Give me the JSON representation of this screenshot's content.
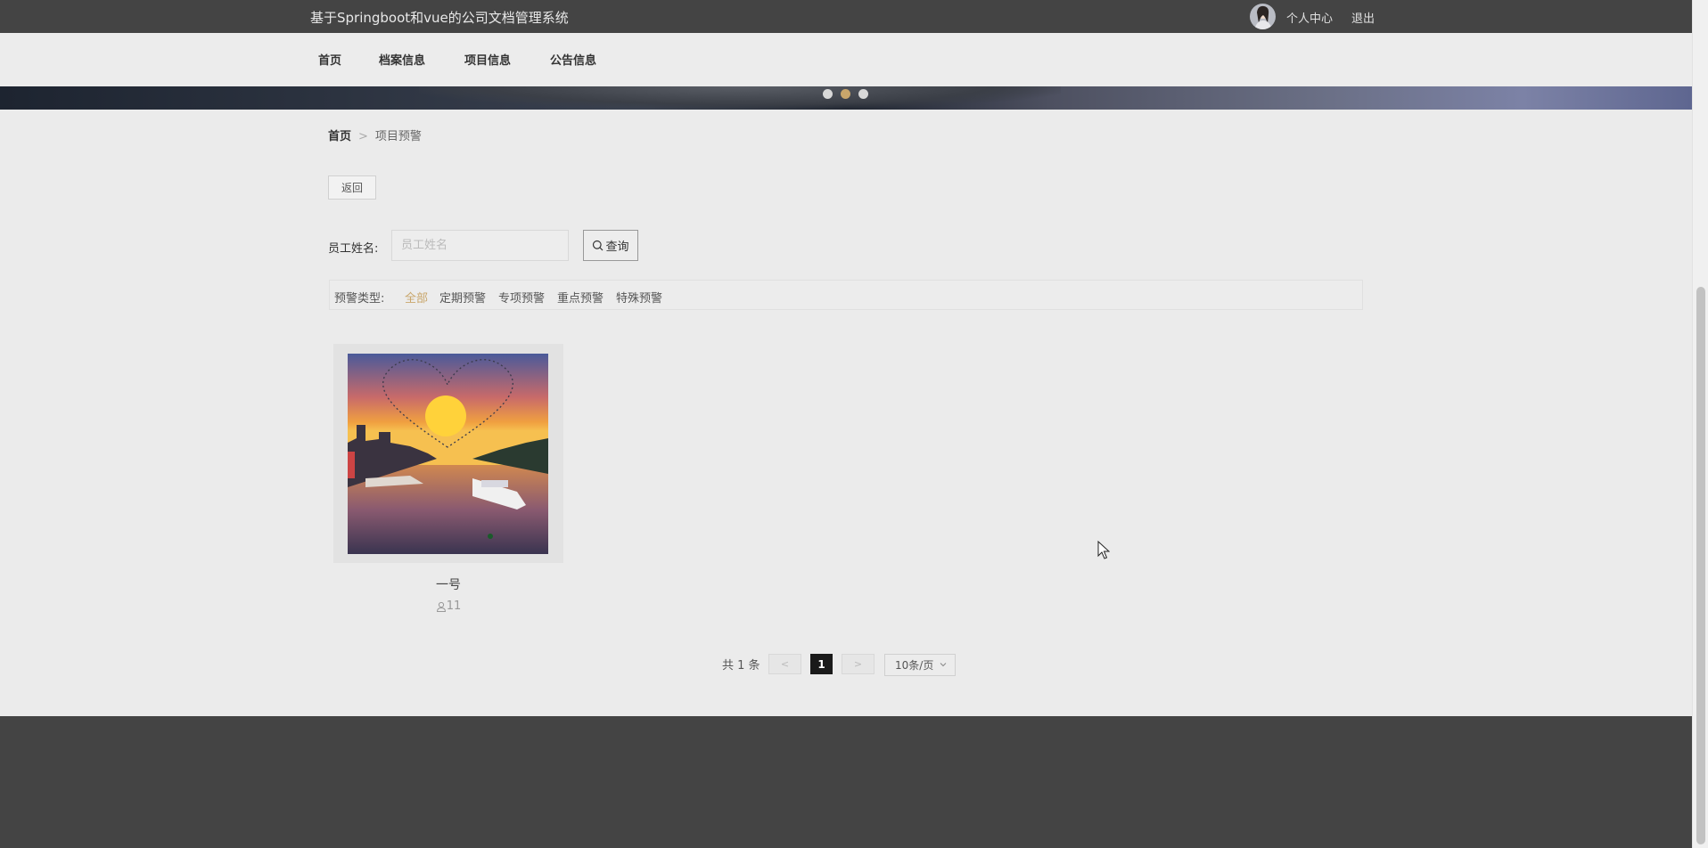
{
  "header": {
    "site_title": "基于Springboot和vue的公司文档管理系统",
    "user_center": "个人中心",
    "logout": "退出"
  },
  "nav": {
    "items": [
      {
        "label": "首页"
      },
      {
        "label": "档案信息"
      },
      {
        "label": "项目信息"
      },
      {
        "label": "公告信息"
      }
    ]
  },
  "carousel": {
    "active_index": 1,
    "count": 3
  },
  "breadcrumb": {
    "home": "首页",
    "separator": ">",
    "current": "项目预警"
  },
  "back_button": "返回",
  "search": {
    "label": "员工姓名:",
    "placeholder": "员工姓名",
    "value": "",
    "button": "查询"
  },
  "filter": {
    "label": "预警类型:",
    "options": [
      {
        "label": "全部",
        "active": true
      },
      {
        "label": "定期预警",
        "active": false
      },
      {
        "label": "专项预警",
        "active": false
      },
      {
        "label": "重点预警",
        "active": false
      },
      {
        "label": "特殊预警",
        "active": false
      }
    ]
  },
  "cards": [
    {
      "name": "一号",
      "count": "11"
    }
  ],
  "pagination": {
    "total": "共 1 条",
    "prev": "<",
    "current_page": "1",
    "next": ">",
    "page_size": "10条/页"
  },
  "colors": {
    "topbar": "#444444",
    "accent": "#c9a66b",
    "footer": "#444444"
  }
}
